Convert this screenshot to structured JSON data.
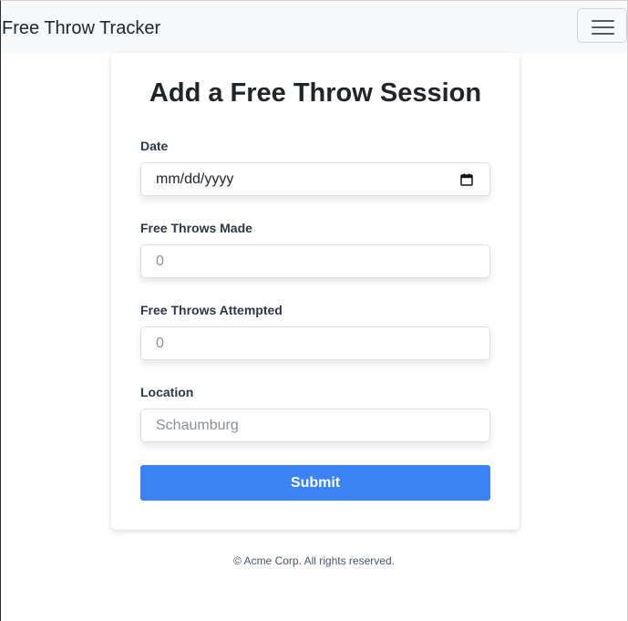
{
  "navbar": {
    "brand": "Free Throw Tracker",
    "menu_icon": "hamburger-menu-icon"
  },
  "form": {
    "title": "Add a Free Throw Session",
    "date": {
      "label": "Date",
      "value": "mm/dd/yyyy",
      "icon": "calendar-icon"
    },
    "made": {
      "label": "Free Throws Made",
      "placeholder": "0"
    },
    "attempted": {
      "label": "Free Throws Attempted",
      "placeholder": "0"
    },
    "location": {
      "label": "Location",
      "placeholder": "Schaumburg"
    },
    "submit_label": "Submit"
  },
  "footer": {
    "text": "© Acme Corp. All rights reserved."
  },
  "colors": {
    "accent": "#3b82f6",
    "navbar_bg": "#f8f9fa",
    "text": "#212529"
  }
}
